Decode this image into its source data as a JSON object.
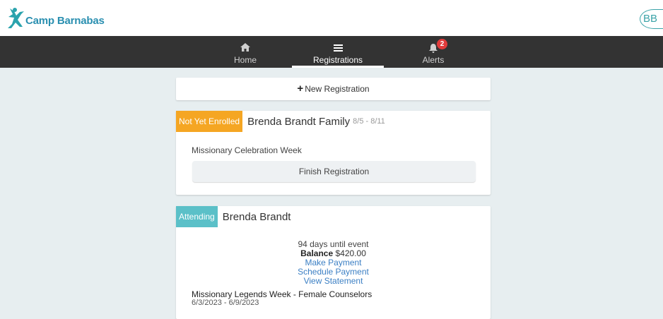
{
  "header": {
    "logo_text": "Camp Barnabas",
    "avatar_initials": "BB"
  },
  "nav": {
    "items": [
      {
        "label": "Home",
        "icon": "home-icon"
      },
      {
        "label": "Registrations",
        "icon": "list-icon",
        "active": true
      },
      {
        "label": "Alerts",
        "icon": "bell-icon",
        "badge": "2"
      }
    ]
  },
  "new_registration": {
    "label": "New Registration"
  },
  "registrations": [
    {
      "status": "Not Yet Enrolled",
      "status_color": "#f5a623",
      "name": "Brenda Brandt Family",
      "dates": "8/5 - 8/11",
      "session": "Missionary Celebration Week",
      "action": "Finish Registration"
    },
    {
      "status": "Attending",
      "status_color": "#5bc0c8",
      "name": "Brenda Brandt",
      "days_until": "94 days until event",
      "balance_label": "Balance",
      "balance_value": "$420.00",
      "links": [
        "Make Payment",
        "Schedule Payment",
        "View Statement"
      ],
      "event_title": "Missionary Legends Week - Female Counselors",
      "event_dates": "6/3/2023 - 6/9/2023"
    }
  ],
  "colors": {
    "nav_bg": "#333333",
    "page_bg": "#e7eef0",
    "link": "#3b7fc4",
    "badge": "#e23b3b"
  }
}
